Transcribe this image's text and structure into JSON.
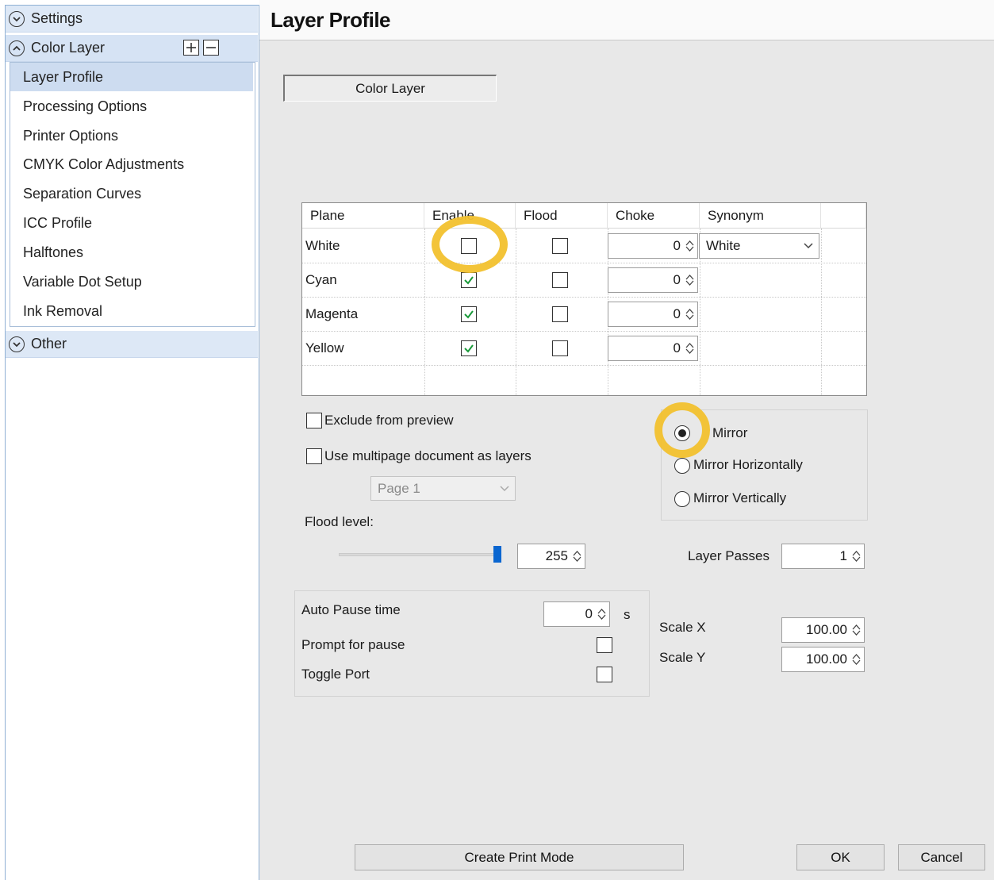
{
  "sidebar": {
    "settings_label": "Settings",
    "color_layer_label": "Color Layer",
    "items": [
      {
        "label": "Layer Profile"
      },
      {
        "label": "Processing Options"
      },
      {
        "label": "Printer Options"
      },
      {
        "label": "CMYK Color Adjustments"
      },
      {
        "label": "Separation Curves"
      },
      {
        "label": "ICC Profile"
      },
      {
        "label": "Halftones"
      },
      {
        "label": "Variable Dot Setup"
      },
      {
        "label": "Ink Removal"
      }
    ],
    "other_label": "Other"
  },
  "main": {
    "title": "Layer Profile",
    "layer_name": "Color Layer",
    "table": {
      "headers": {
        "plane": "Plane",
        "enable": "Enable",
        "flood": "Flood",
        "choke": "Choke",
        "synonym": "Synonym"
      },
      "rows": [
        {
          "plane": "White",
          "enabled": false,
          "flood": false,
          "choke": "0",
          "synonym": "White"
        },
        {
          "plane": "Cyan",
          "enabled": true,
          "flood": false,
          "choke": "0"
        },
        {
          "plane": "Magenta",
          "enabled": true,
          "flood": false,
          "choke": "0"
        },
        {
          "plane": "Yellow",
          "enabled": true,
          "flood": false,
          "choke": "0"
        }
      ]
    },
    "exclude_preview_label": "Exclude from preview",
    "multipage_label": "Use multipage document as layers",
    "page_select_value": "Page 1",
    "flood_level_label": "Flood level:",
    "flood_level_value": "255",
    "flood_level_fraction": 1.0,
    "mirror": {
      "options": [
        "No Mirror",
        "Mirror Horizontally",
        "Mirror Vertically"
      ],
      "no_mirror_visible": "Mirror",
      "selected": 0
    },
    "layer_passes_label": "Layer Passes",
    "layer_passes_value": "1",
    "auto_pause_label": "Auto Pause time",
    "auto_pause_value": "0",
    "auto_pause_unit": "s",
    "prompt_pause_label": "Prompt for pause",
    "toggle_port_label": "Toggle Port",
    "scale_x_label": "Scale X",
    "scale_x_value": "100.00",
    "scale_y_label": "Scale Y",
    "scale_y_value": "100.00",
    "buttons": {
      "create": "Create Print Mode",
      "ok": "OK",
      "cancel": "Cancel"
    }
  },
  "colors": {
    "highlight": "#f2c12e",
    "check": "#1a9a3a",
    "selection": "#cddcf0",
    "slider": "#0a66d0"
  }
}
